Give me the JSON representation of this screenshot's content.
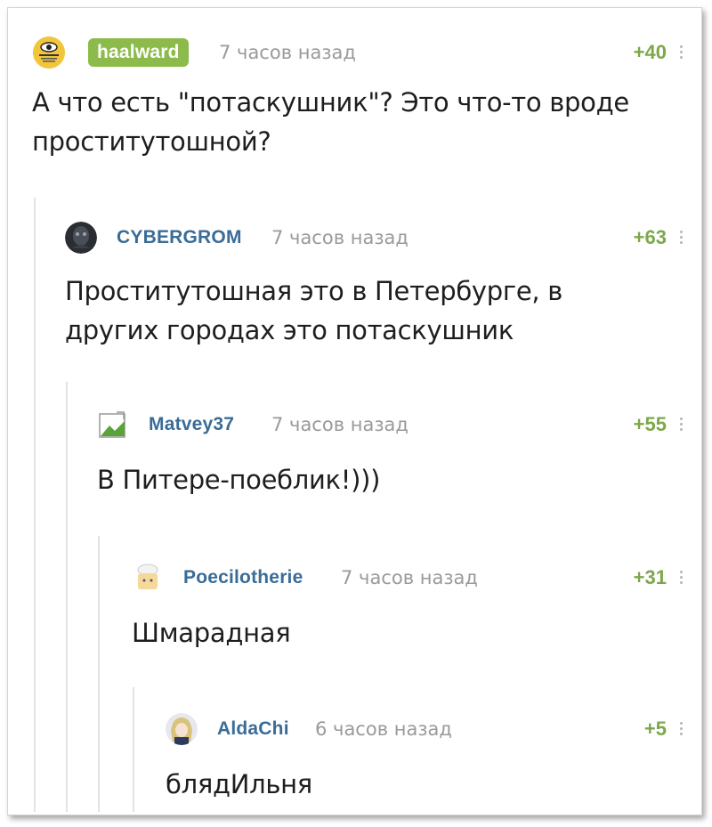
{
  "comments": [
    {
      "author": "haalward",
      "time": "7 часов назад",
      "score": "+40",
      "text_lines": [
        "А что есть \"потаскушник\"? Это что-то вроде",
        "проститутошной?"
      ],
      "avatar_icon": "government-eye-avatar"
    },
    {
      "author": "CYBERGROM",
      "time": "7 часов назад",
      "score": "+63",
      "text_lines": [
        "Проститутошная это в Петербурге, в",
        "других городах это потаскушник"
      ],
      "avatar_icon": "dark-creature-avatar"
    },
    {
      "author": "Matvey37",
      "time": "7 часов назад",
      "score": "+55",
      "text_lines": [
        "В Питере-поеблик!)))"
      ],
      "avatar_icon": "broken-image-avatar"
    },
    {
      "author": "Poecilotherie",
      "time": "7 часов назад",
      "score": "+31",
      "text_lines": [
        "Шмарадная"
      ],
      "avatar_icon": "chef-avatar"
    },
    {
      "author": "AldaChi",
      "time": "6 часов назад",
      "score": "+5",
      "text_lines": [
        "блядИльня"
      ],
      "avatar_icon": "anime-girl-avatar"
    }
  ],
  "colors": {
    "author": "#3a6c97",
    "author_badge_bg": "#8cbb4b",
    "score": "#7da84a",
    "time": "#9a9a9a",
    "thread_line": "#e3e3e3"
  }
}
